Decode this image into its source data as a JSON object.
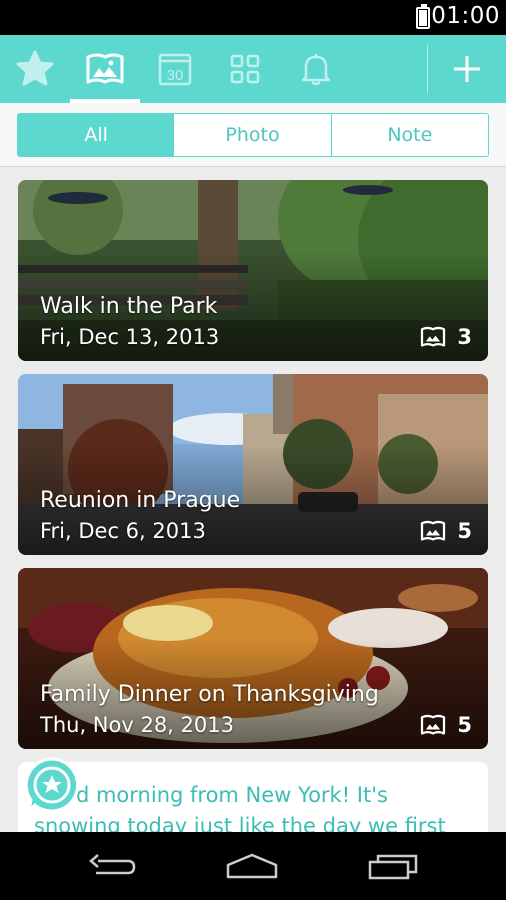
{
  "status_bar": {
    "time": "01:00"
  },
  "app_bar": {
    "tabs": [
      {
        "icon": "star-icon"
      },
      {
        "icon": "album-icon",
        "active": true
      },
      {
        "icon": "calendar-icon",
        "label": "30"
      },
      {
        "icon": "grid-icon"
      },
      {
        "icon": "bell-icon"
      }
    ],
    "add_icon": "plus-icon"
  },
  "filter": {
    "options": [
      "All",
      "Photo",
      "Note"
    ],
    "selected": "All"
  },
  "cards": [
    {
      "title": "Walk in the Park",
      "date": "Fri, Dec 13, 2013",
      "count": "3"
    },
    {
      "title": "Reunion in Prague",
      "date": "Fri, Dec 6, 2013",
      "count": "5"
    },
    {
      "title": "Family Dinner on Thanksgiving",
      "date": "Thu, Nov 28, 2013",
      "count": "5"
    }
  ],
  "note": {
    "text": "Good morning from New York! It's snowing today just like the day we first met! I feel so"
  },
  "colors": {
    "accent": "#5cd8cf",
    "accent_text": "#4cc6bd",
    "note_text": "#3cbdb4"
  }
}
